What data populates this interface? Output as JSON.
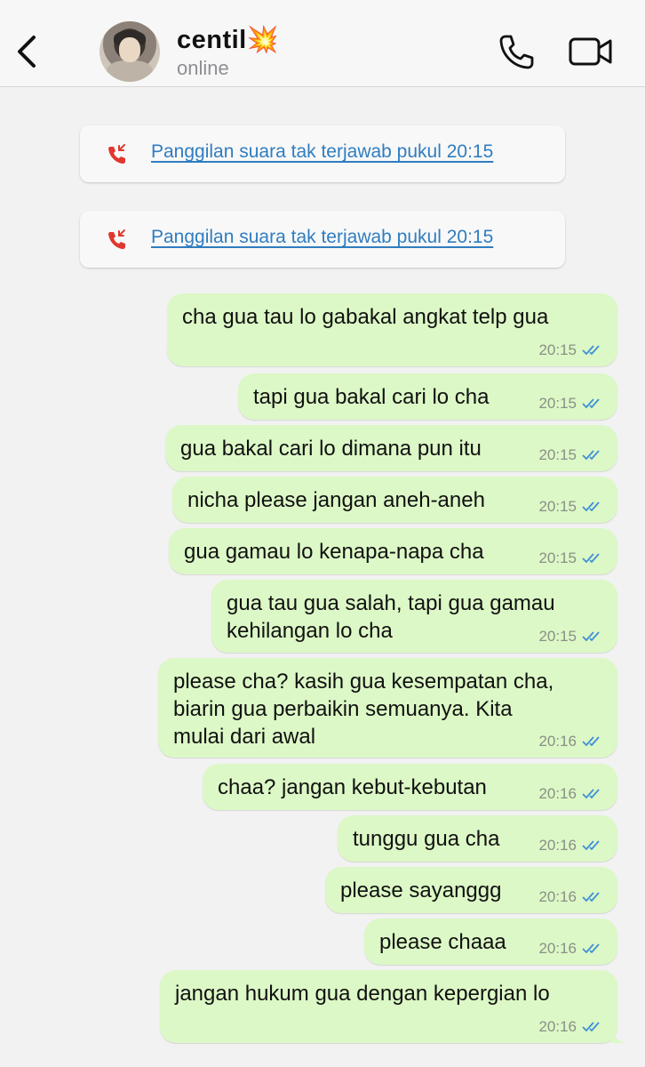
{
  "header": {
    "contact_name": "centil💥",
    "status": "online"
  },
  "call_notices": [
    {
      "text": "Panggilan suara tak terjawab pukul 20:15"
    },
    {
      "text": "Panggilan suara tak terjawab pukul 20:15"
    }
  ],
  "messages": [
    {
      "text": "cha gua tau lo gabakal angkat telp gua",
      "time": "20:15"
    },
    {
      "text": "tapi gua bakal cari lo cha",
      "time": "20:15"
    },
    {
      "text": "gua bakal cari lo dimana pun itu",
      "time": "20:15"
    },
    {
      "text": "nicha please jangan aneh-aneh",
      "time": "20:15"
    },
    {
      "text": "gua gamau lo kenapa-napa cha",
      "time": "20:15"
    },
    {
      "text": "gua tau gua salah, tapi gua gamau\nkehilangan lo cha",
      "time": "20:15"
    },
    {
      "text": "please cha? kasih gua kesempatan cha,\nbiarin gua perbaikin semuanya. Kita\nmulai dari awal",
      "time": "20:16"
    },
    {
      "text": "chaa? jangan kebut-kebutan",
      "time": "20:16"
    },
    {
      "text": "tunggu gua cha",
      "time": "20:16"
    },
    {
      "text": "please sayanggg",
      "time": "20:16"
    },
    {
      "text": "please chaaa",
      "time": "20:16"
    },
    {
      "text": "jangan hukum gua dengan kepergian lo",
      "time": "20:16"
    }
  ],
  "colors": {
    "bubble": "#dcf8c6",
    "link": "#2f7dc0",
    "missed_call": "#e0382f",
    "read_ticks": "#3e8fd6"
  }
}
